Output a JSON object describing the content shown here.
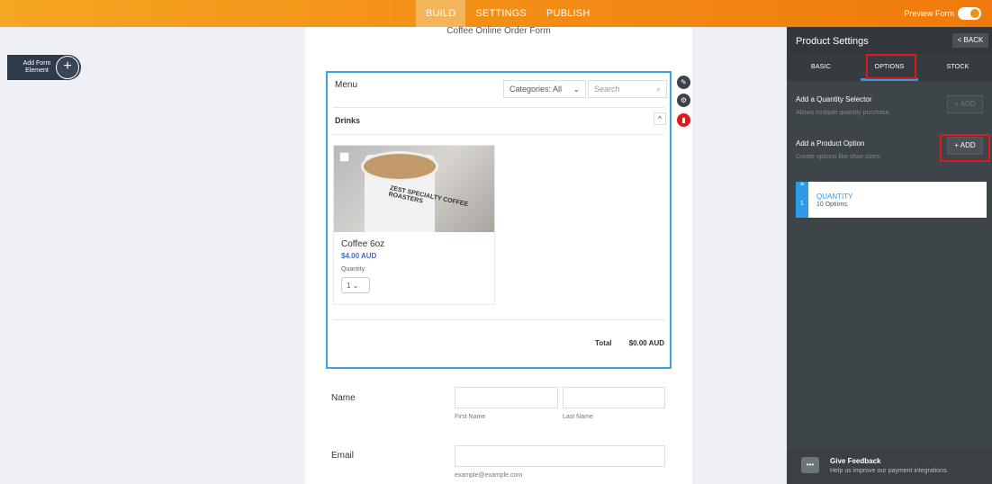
{
  "topbar": {
    "tabs": [
      {
        "label": "BUILD",
        "active": true
      },
      {
        "label": "SETTINGS",
        "active": false
      },
      {
        "label": "PUBLISH",
        "active": false
      }
    ],
    "preview_label": "Preview Form"
  },
  "sidebar": {
    "add_element_label": "Add Form Element",
    "add_icon": "plus-icon"
  },
  "form": {
    "title": "Coffee Online Order Form",
    "product_list": {
      "menu_label": "Menu",
      "category_select": "Categories: All",
      "search_placeholder": "Search",
      "group_label": "Drinks",
      "product": {
        "name": "Coffee 6oz",
        "price": "$4.00 AUD",
        "quantity_label": "Quantity",
        "quantity_value": "1",
        "image_text": "ZEST SPECIALTY COFFEE ROASTERS"
      },
      "total_label": "Total",
      "total_value": "$0.00 AUD"
    },
    "name_field": {
      "label": "Name",
      "first_sublabel": "First Name",
      "last_sublabel": "Last Name"
    },
    "email_field": {
      "label": "Email",
      "sublabel": "example@example.com"
    }
  },
  "panel": {
    "title": "Product Settings",
    "back_label": "< BACK",
    "tabs": [
      {
        "label": "BASIC",
        "active": false
      },
      {
        "label": "OPTIONS",
        "active": true
      },
      {
        "label": "STOCK",
        "active": false
      }
    ],
    "quantity_selector": {
      "title": "Add a Quantity Selector",
      "subtitle": "Allows multiple quantity purchase.",
      "button": "+ ADD"
    },
    "product_option": {
      "title": "Add a Product Option",
      "subtitle": "Create options like shoe sizes.",
      "button": "+ ADD"
    },
    "option_card": {
      "title": "QUANTITY",
      "subtitle": "10 Options.",
      "index": "1"
    },
    "feedback": {
      "title": "Give Feedback",
      "subtitle": "Help us improve our payment integrations."
    }
  },
  "colors": {
    "topbar": "#f39016",
    "accent_blue": "#2e9bea",
    "highlight_red": "#e0171b",
    "panel_bg": "#3e4549"
  }
}
